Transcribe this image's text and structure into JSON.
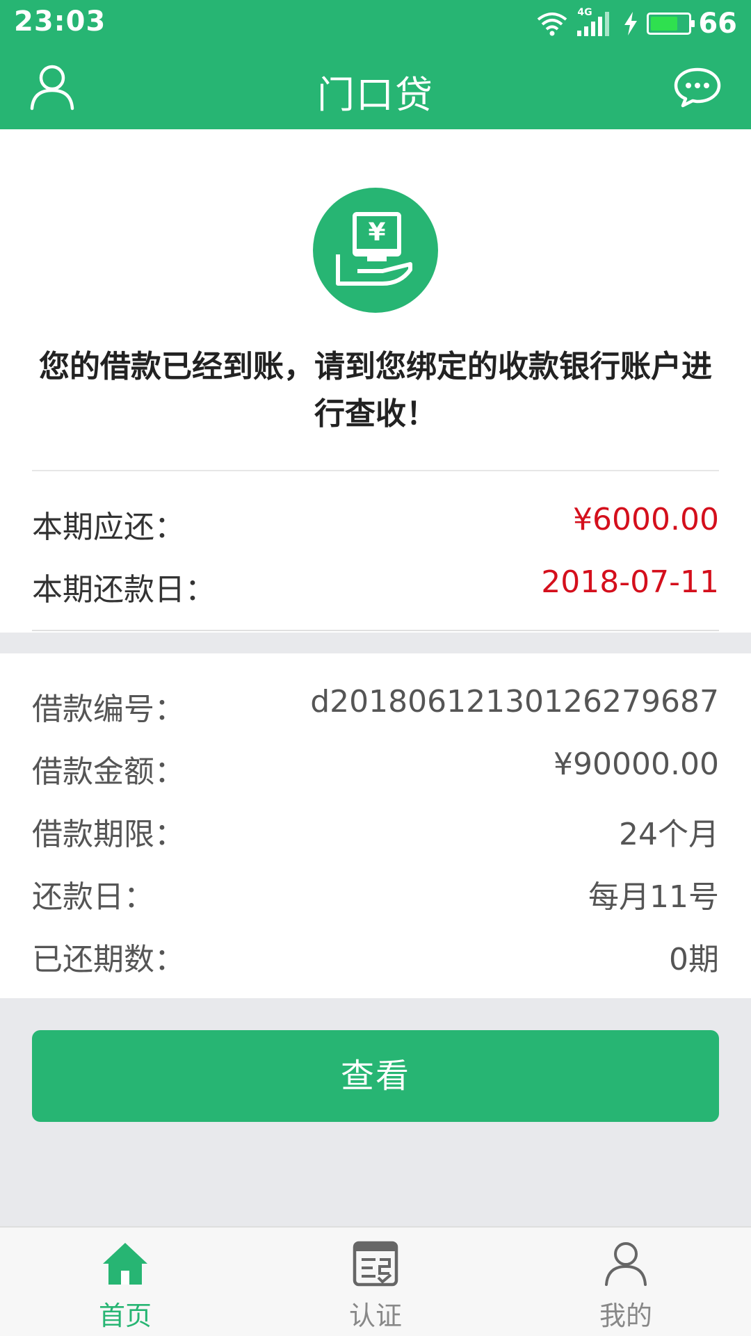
{
  "status_bar": {
    "time": "23:03",
    "network": "4G",
    "battery": "66"
  },
  "navbar": {
    "title": "门口贷",
    "left_icon": "user-icon",
    "right_icon": "chat-bubble-icon"
  },
  "summary": {
    "icon": "money-hand-icon",
    "message": "您的借款已经到账，请到您绑定的收款银行账户进行查收！",
    "rows": [
      {
        "label": "本期应还：",
        "value": "¥6000.00"
      },
      {
        "label": "本期还款日：",
        "value": "2018-07-11"
      }
    ]
  },
  "details": {
    "rows": [
      {
        "label": "借款编号：",
        "value": "d20180612130126279687"
      },
      {
        "label": "借款金额：",
        "value": "¥90000.00"
      },
      {
        "label": "借款期限：",
        "value": "24个月"
      },
      {
        "label": "还款日：",
        "value": "每月11号"
      },
      {
        "label": "已还期数：",
        "value": "0期"
      }
    ]
  },
  "actions": {
    "view_label": "查看"
  },
  "tabs": [
    {
      "label": "首页",
      "icon": "home-icon",
      "active": true
    },
    {
      "label": "认证",
      "icon": "verify-icon",
      "active": false
    },
    {
      "label": "我的",
      "icon": "profile-icon",
      "active": false
    }
  ],
  "colors": {
    "brand": "#27b573",
    "highlight": "#d40f1c"
  }
}
